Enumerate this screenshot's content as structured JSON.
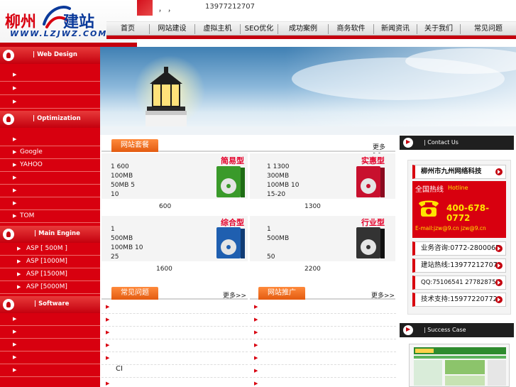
{
  "logo": {
    "name_red": "柳州",
    "name_blue": "建站",
    "url": "WWW.LZJWZ.COM"
  },
  "topbar": {
    "text": "，   ，",
    "phone": "13977212707"
  },
  "nav": [
    "首页",
    "网站建设",
    "虚拟主机",
    "SEO优化",
    "成功案例",
    "商务软件",
    "新闻资讯",
    "关于我们",
    "常见问题"
  ],
  "sidebar": {
    "sections": [
      {
        "title": "| Web Design",
        "icon": "heart-icon",
        "items": [
          "",
          "",
          ""
        ]
      },
      {
        "title": "| Optimization",
        "icon": "person-icon",
        "items": [
          "",
          "Google",
          "YAHOO",
          "",
          "",
          "",
          "TOM"
        ]
      },
      {
        "title": "| Main Engine",
        "icon": "spade-icon",
        "items": [
          "ASP [ 500M ]",
          "ASP [1000M]",
          "ASP [1500M]",
          "ASP [5000M]"
        ]
      },
      {
        "title": "| Software",
        "icon": "bell-icon",
        "items": [
          "",
          "",
          "",
          "",
          ""
        ]
      }
    ]
  },
  "packages": {
    "tab": "网站套餐",
    "more": "更多>>",
    "items": [
      {
        "type": "简易型",
        "lines": [
          "1  600",
          "100MB",
          "50MB  5",
          "10"
        ],
        "price": "600",
        "color": "#3a9a2a"
      },
      {
        "type": "实惠型",
        "lines": [
          "1  1300",
          "300MB",
          "100MB  10",
          "15-20"
        ],
        "price": "1300",
        "color": "#c8102e"
      },
      {
        "type": "综合型",
        "lines": [
          "1",
          "500MB",
          "100MB  10",
          "25"
        ],
        "price": "1600",
        "color": "#1f5fb0"
      },
      {
        "type": "行业型",
        "lines": [
          "1",
          "500MB",
          "",
          "50"
        ],
        "price": "2200",
        "color": "#333333"
      }
    ]
  },
  "faq": {
    "tab": "常见问题",
    "more": "更多>>",
    "items": [
      "",
      "",
      "",
      "",
      "",
      "CI",
      ""
    ]
  },
  "promo": {
    "tab": "网站推广",
    "more": "更多>>",
    "items": [
      "",
      "",
      "",
      "",
      "",
      "",
      ""
    ]
  },
  "contact": {
    "header": "| Contact Us",
    "company": "柳州市九州网络科技",
    "hotline_label": "全国热线",
    "hotline_en": "Hotline",
    "hotline_number": "400-678-0772",
    "email": "E-mail:jzw@9.cn  jzw@9.cn",
    "rows": [
      "业务咨询:0772-2800065",
      "建站热线:13977212707",
      "QQ:75106541  277828755",
      "技术支持:15977220772"
    ]
  },
  "success": {
    "header": "| Success Case"
  },
  "colors": {
    "brand_red": "#d8000f",
    "nav_gray": "#dcdcdc",
    "tab_orange": "#e35b10",
    "hotline_yellow": "#ffe400"
  }
}
